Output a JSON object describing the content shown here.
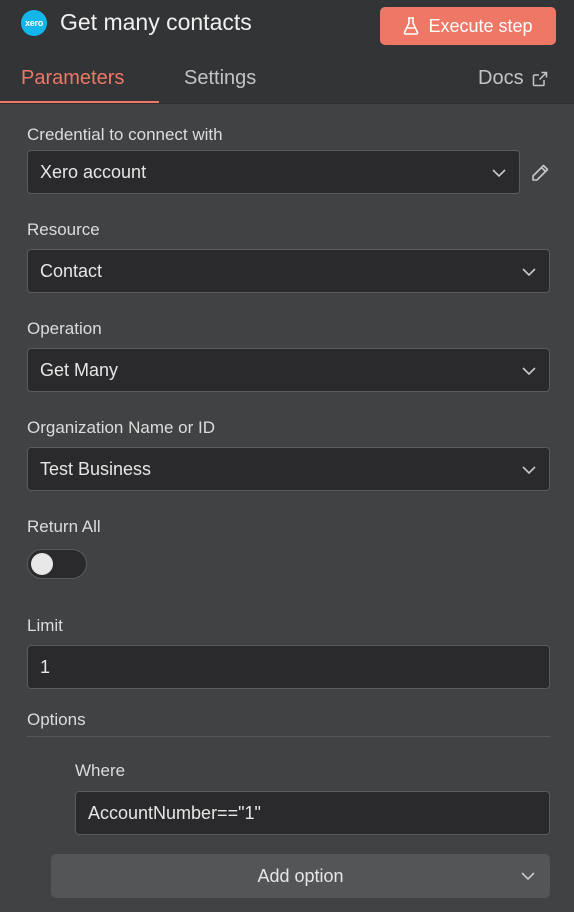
{
  "header": {
    "logo_text": "xero",
    "title": "Get many contacts",
    "execute_label": "Execute step",
    "accent_color": "#ee7766"
  },
  "tabs": {
    "parameters": "Parameters",
    "settings": "Settings",
    "docs": "Docs"
  },
  "fields": {
    "credential": {
      "label": "Credential to connect with",
      "value": "Xero account"
    },
    "resource": {
      "label": "Resource",
      "value": "Contact"
    },
    "operation": {
      "label": "Operation",
      "value": "Get Many"
    },
    "organization": {
      "label": "Organization Name or ID",
      "value": "Test Business"
    },
    "return_all": {
      "label": "Return All",
      "value": false
    },
    "limit": {
      "label": "Limit",
      "value": "1"
    }
  },
  "options": {
    "label": "Options",
    "where": {
      "label": "Where",
      "value": "AccountNumber==\"1\""
    },
    "add_option_label": "Add option"
  },
  "icons": {
    "execute": "flask-icon",
    "docs": "external-link-icon",
    "edit": "pencil-icon",
    "dropdown": "chevron-down-icon"
  }
}
